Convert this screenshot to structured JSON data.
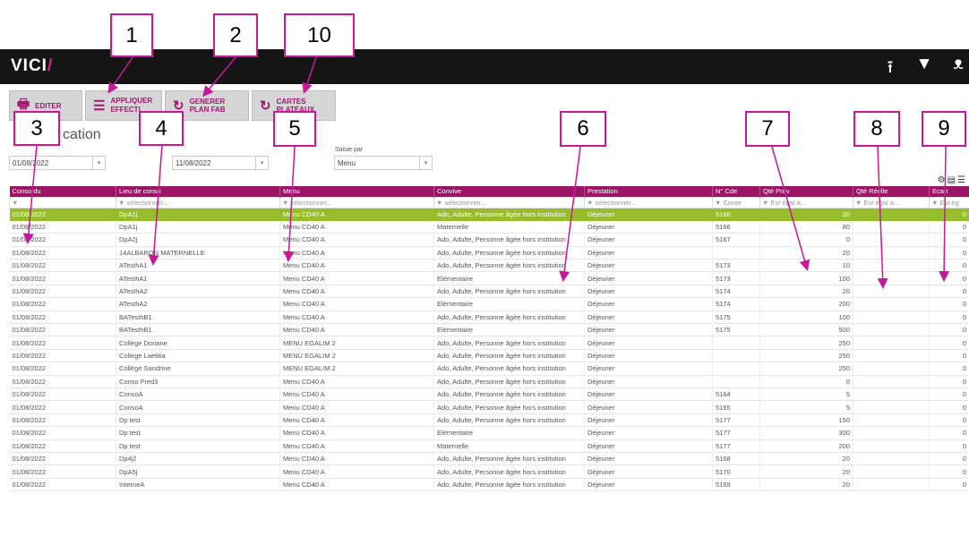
{
  "app": {
    "logo": "VICI",
    "logo_mark": "/"
  },
  "header_icons": [
    "upload-icon",
    "filter-icon",
    "user-icon"
  ],
  "toolbar": {
    "editer": "EDITER",
    "appliquer": "APPLIQUER",
    "appliquer_sub": "EFFECTI",
    "plan": "GENERER PLAN FAB",
    "cartes": "CARTES PLATEAUX"
  },
  "page_title": "cation",
  "filters": {
    "date_from": "01/08/2022",
    "date_to": "11/08/2022",
    "saisie_label": "Saisie par",
    "saisie_value": "Menu"
  },
  "callouts": [
    "1",
    "2",
    "10",
    "3",
    "4",
    "5",
    "6",
    "7",
    "8",
    "9"
  ],
  "table": {
    "columns": [
      "Conso du",
      "Lieu de conso",
      "Menu",
      "Convive",
      "Prestation",
      "N° Cde",
      "Qté Prév",
      "Qté Réelle",
      "Ecart"
    ],
    "filter_row": [
      "▼",
      "▼ sélectionner...",
      "▼ sélectionner...",
      "▼ sélectionner...",
      "▼ sélectionner...",
      "▼ Conte",
      "▼ Est égal à...",
      "▼ Est égal à...",
      "▼ Est ég"
    ],
    "rows": [
      [
        "01/08/2022",
        "DpA1j",
        "Menu CD40 A",
        "Ado, Adulte, Personne âgée hors institution",
        "Déjeuner",
        "5166",
        "20",
        "",
        "0"
      ],
      [
        "01/08/2022",
        "DpA1j",
        "Menu CD40 A",
        "Maternelle",
        "Déjeuner",
        "5166",
        "80",
        "",
        "0"
      ],
      [
        "01/08/2022",
        "DpA2j",
        "Menu CD40 A",
        "Ado, Adulte, Personne âgée hors institution",
        "Déjeuner",
        "5167",
        "0",
        "",
        "0"
      ],
      [
        "01/08/2022",
        "14ALBARON MATERNELLE",
        "Menu CD40 A",
        "Ado, Adulte, Personne âgée hors institution",
        "Déjeuner",
        "",
        "20",
        "",
        "0"
      ],
      [
        "01/08/2022",
        "ATesthA1",
        "Menu CD40 A",
        "Ado, Adulte, Personne âgée hors institution",
        "Déjeuner",
        "5173",
        "10",
        "",
        "0"
      ],
      [
        "01/08/2022",
        "ATesthA1",
        "Menu CD40 A",
        "Elémentaire",
        "Déjeuner",
        "5173",
        "100",
        "",
        "0"
      ],
      [
        "01/08/2022",
        "ATesthA2",
        "Menu CD40 A",
        "Ado, Adulte, Personne âgée hors institution",
        "Déjeuner",
        "5174",
        "20",
        "",
        "0"
      ],
      [
        "01/08/2022",
        "ATesthA2",
        "Menu CD40 A",
        "Elémentaire",
        "Déjeuner",
        "5174",
        "200",
        "",
        "0"
      ],
      [
        "01/08/2022",
        "BATesthB1",
        "Menu CD40 A",
        "Ado, Adulte, Personne âgée hors institution",
        "Déjeuner",
        "5175",
        "100",
        "",
        "0"
      ],
      [
        "01/08/2022",
        "BATesthB1",
        "Menu CD40 A",
        "Elémentaire",
        "Déjeuner",
        "5175",
        "500",
        "",
        "0"
      ],
      [
        "01/08/2022",
        "Collège Doriane",
        "MENU EGALIM 2",
        "Ado, Adulte, Personne âgée hors institution",
        "Déjeuner",
        "",
        "250",
        "",
        "0"
      ],
      [
        "01/08/2022",
        "College Laetitia",
        "MENU EGALIM 2",
        "Ado, Adulte, Personne âgée hors institution",
        "Déjeuner",
        "",
        "250",
        "",
        "0"
      ],
      [
        "01/08/2022",
        "Collège Sandrine",
        "MENU EGALIM 2",
        "Ado, Adulte, Personne âgée hors institution",
        "Déjeuner",
        "",
        "250",
        "",
        "0"
      ],
      [
        "01/08/2022",
        "Conso Fred3",
        "Menu CD40 A",
        "Ado, Adulte, Personne âgée hors institution",
        "Déjeuner",
        "",
        "0",
        "",
        "0"
      ],
      [
        "01/08/2022",
        "ConsoA",
        "Menu CD40 A",
        "Ado, Adulte, Personne âgée hors institution",
        "Déjeuner",
        "5164",
        "5",
        "",
        "0"
      ],
      [
        "01/08/2022",
        "ConsoA",
        "Menu CD40 A",
        "Ado, Adulte, Personne âgée hors institution",
        "Déjeuner",
        "5165",
        "5",
        "",
        "0"
      ],
      [
        "01/08/2022",
        "Dp test",
        "Menu CD40 A",
        "Ado, Adulte, Personne âgée hors institution",
        "Déjeuner",
        "5177",
        "150",
        "",
        "0"
      ],
      [
        "01/08/2022",
        "Dp test",
        "Menu CD40 A",
        "Elémentaire",
        "Déjeuner",
        "5177",
        "300",
        "",
        "0"
      ],
      [
        "01/08/2022",
        "Dp test",
        "Menu CD40 A",
        "Maternelle",
        "Déjeuner",
        "5177",
        "200",
        "",
        "0"
      ],
      [
        "01/08/2022",
        "Dp4j2",
        "Menu CD40 A",
        "Ado, Adulte, Personne âgée hors institution",
        "Déjeuner",
        "5168",
        "20",
        "",
        "0"
      ],
      [
        "01/08/2022",
        "DpA5j",
        "Menu CD40 A",
        "Ado, Adulte, Personne âgée hors institution",
        "Déjeuner",
        "5170",
        "20",
        "",
        "0"
      ],
      [
        "01/08/2022",
        "InterneA",
        "Menu CD40 A",
        "Ado, Adulte, Personne âgée hors institution",
        "Déjeuner",
        "5169",
        "20",
        "",
        "0"
      ]
    ]
  },
  "colors": {
    "brand": "#9b1466",
    "selected_row": "#97bd2c",
    "topbar": "#151515",
    "callout": "#c8189a"
  }
}
